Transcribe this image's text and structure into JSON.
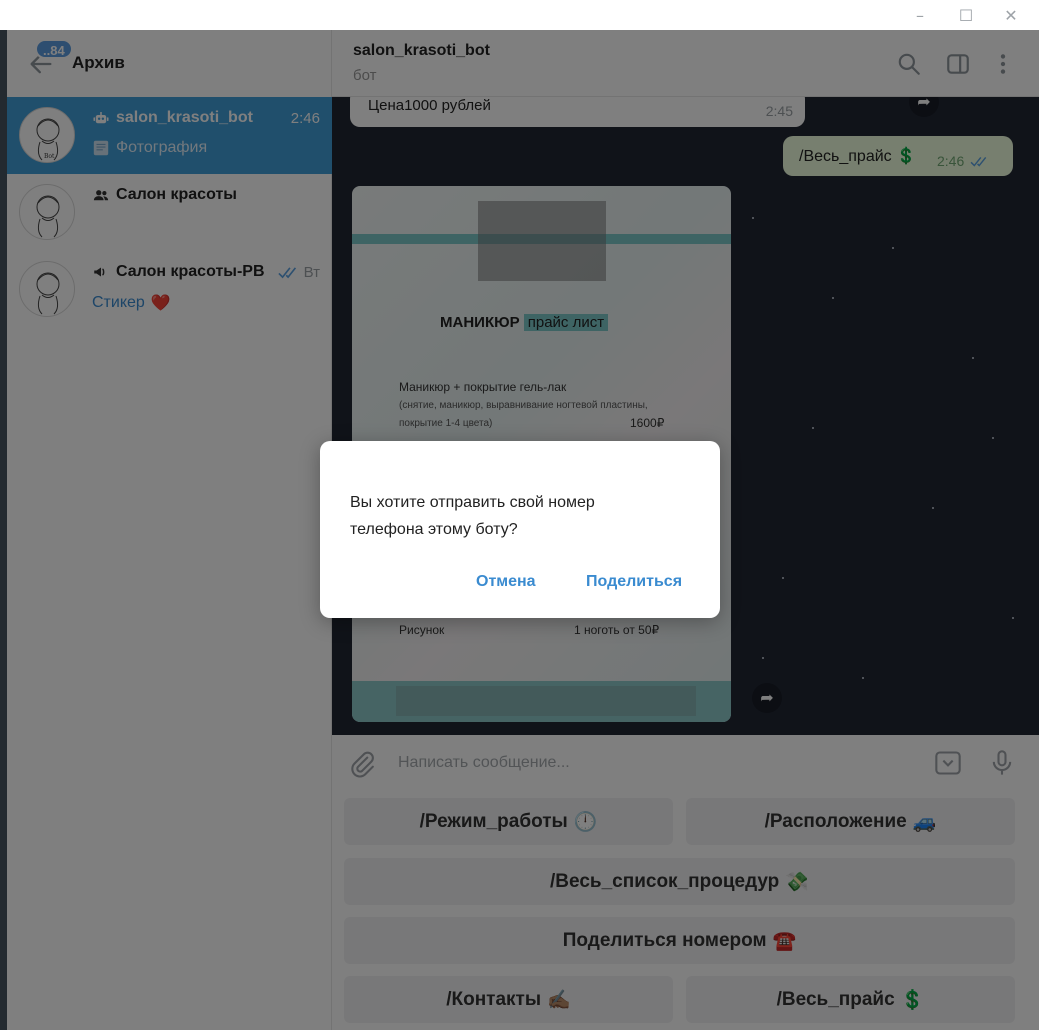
{
  "window": {
    "minimize_glyph": "–",
    "maximize_glyph": "☐",
    "close_glyph": "✕"
  },
  "sidebar": {
    "badge": "..84",
    "title": "Архив",
    "chats": [
      {
        "name": "salon_krasoti_bot",
        "time": "2:46",
        "preview": "Фотография",
        "type": "bot",
        "active": true
      },
      {
        "name": "Салон красоты",
        "time": "",
        "preview": "",
        "type": "group",
        "active": false
      },
      {
        "name": "Салон красоты-РВ",
        "time": "Вт",
        "preview": "Стикер",
        "preview_emoji": "❤️",
        "type": "channel",
        "active": false
      }
    ]
  },
  "chat_header": {
    "title": "salon_krasoti_bot",
    "status": "бот"
  },
  "messages": {
    "incoming_text": "Цена1000 рублей",
    "incoming_time": "2:45",
    "outgoing_text": "/Весь_прайс 💲",
    "outgoing_time": "2:46"
  },
  "photo": {
    "heading": "МАНИКЮР",
    "heading_highlight": "прайс лист",
    "item1_title": "Маникюр + покрытие гель-лак",
    "item1_desc": "(снятие, маникюр, выравнивание ногтевой пластины,",
    "item1_desc2": "покрытие 1-4 цвета)",
    "item1_price": "1600₽",
    "item2_title": "Рисунок",
    "item2_price": "1 ноготь от 50₽"
  },
  "input": {
    "placeholder": "Написать сообщение..."
  },
  "keyboard": {
    "row1": [
      {
        "label": "/Режим_работы",
        "emoji": "🕛"
      },
      {
        "label": "/Расположение",
        "emoji": "🚙"
      }
    ],
    "row2": [
      {
        "label": "/Весь_список_процедур",
        "emoji": "💸"
      }
    ],
    "row3": [
      {
        "label": "Поделиться номером",
        "emoji": "☎️"
      }
    ],
    "row4": [
      {
        "label": "/Контакты",
        "emoji": "✍🏽"
      },
      {
        "label": "/Весь_прайс",
        "emoji": "💲"
      }
    ]
  },
  "dialog": {
    "text": "Вы хотите отправить свой номер телефона этому боту?",
    "cancel": "Отмена",
    "share": "Поделиться"
  },
  "colors": {
    "accent": "#419fd9",
    "link": "#3a8bd0",
    "outgoing_bubble": "#eeffde",
    "photo_band": "#7cc8c9"
  }
}
